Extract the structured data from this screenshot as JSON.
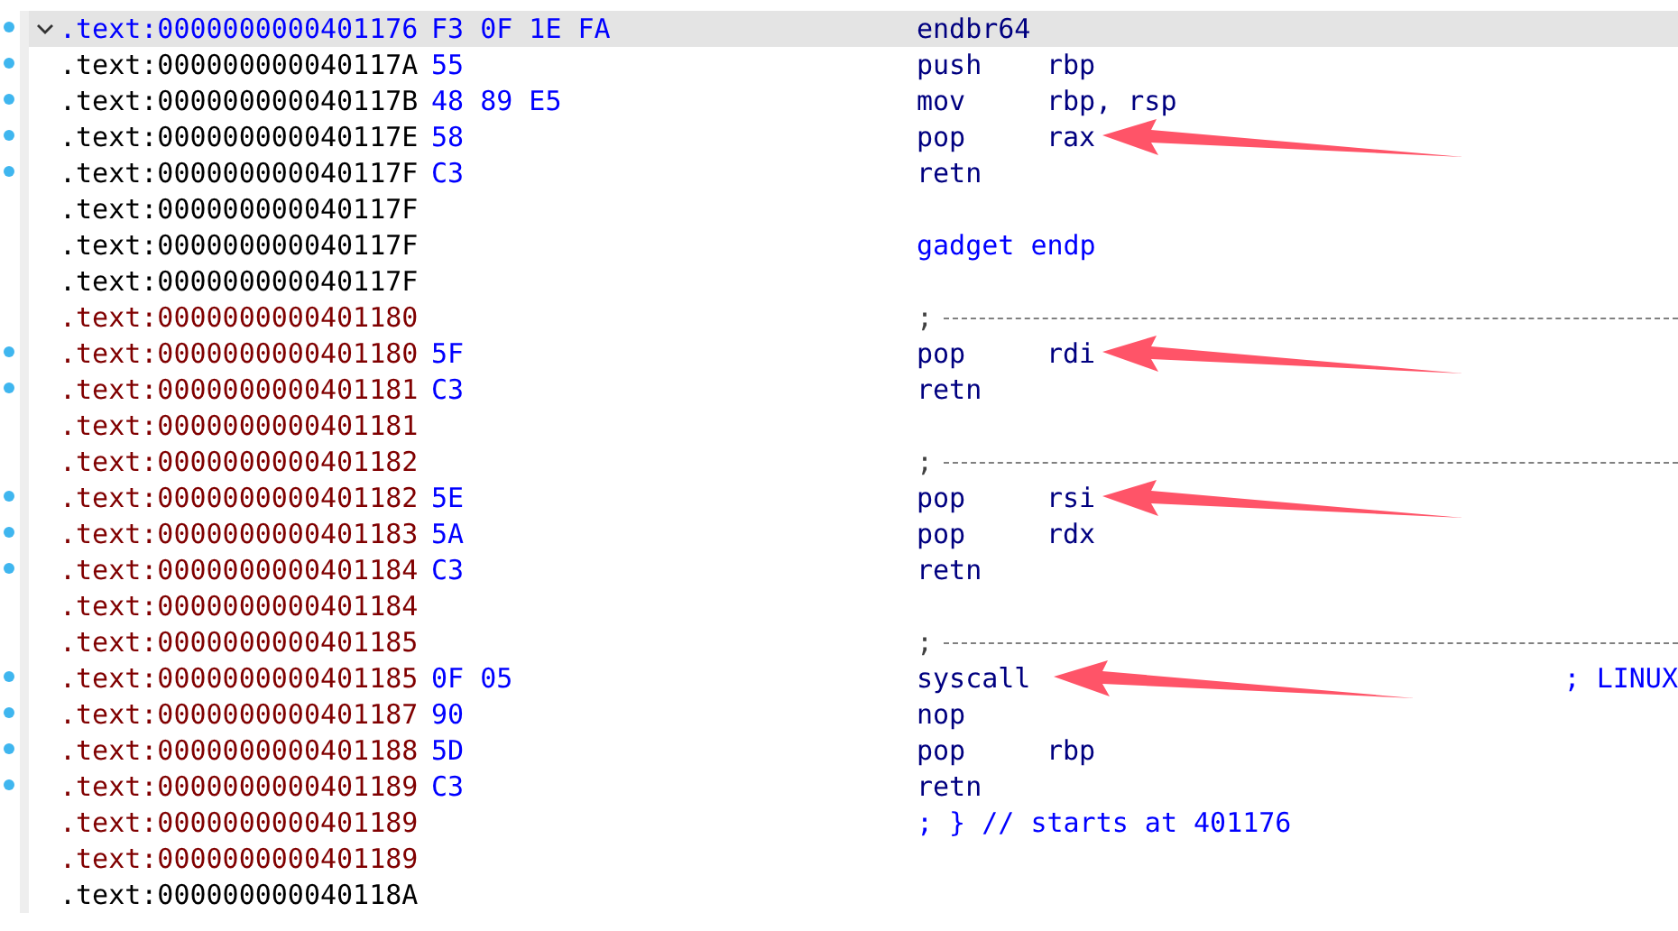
{
  "rows": [
    {
      "kind": "code",
      "address": ".text:0000000000401176",
      "color": "#0000ff",
      "marked": true,
      "selected": true,
      "expanded": true,
      "bytes": "F3 0F 1E FA",
      "mnemonic": "endbr64",
      "arrow": false
    },
    {
      "kind": "code",
      "address": ".text:000000000040117A",
      "color": "#000000",
      "marked": true,
      "selected": false,
      "bytes": "55",
      "mnemonic": "push",
      "operand": "rbp",
      "arrow": false
    },
    {
      "kind": "code",
      "address": ".text:000000000040117B",
      "color": "#000000",
      "marked": true,
      "selected": false,
      "bytes": "48 89 E5",
      "mnemonic": "mov",
      "operand": "rbp, rsp",
      "arrow": false
    },
    {
      "kind": "code",
      "address": ".text:000000000040117E",
      "color": "#000000",
      "marked": true,
      "selected": false,
      "bytes": "58",
      "mnemonic": "pop",
      "operand": "rax",
      "arrow": true
    },
    {
      "kind": "code",
      "address": ".text:000000000040117F",
      "color": "#000000",
      "marked": true,
      "selected": false,
      "bytes": "C3",
      "mnemonic": "retn",
      "arrow": false
    },
    {
      "kind": "blank",
      "address": ".text:000000000040117F",
      "color": "#000000",
      "marked": false,
      "selected": false
    },
    {
      "kind": "label",
      "address": ".text:000000000040117F",
      "color": "#000000",
      "marked": false,
      "selected": false,
      "text": "gadget endp"
    },
    {
      "kind": "blank",
      "address": ".text:000000000040117F",
      "color": "#000000",
      "marked": false,
      "selected": false
    },
    {
      "kind": "separator",
      "address": ".text:0000000000401180",
      "color": "#800000",
      "marked": false,
      "selected": false,
      "text": ";"
    },
    {
      "kind": "code",
      "address": ".text:0000000000401180",
      "color": "#800000",
      "marked": true,
      "selected": false,
      "bytes": "5F",
      "mnemonic": "pop",
      "operand": "rdi",
      "arrow": true
    },
    {
      "kind": "code",
      "address": ".text:0000000000401181",
      "color": "#800000",
      "marked": true,
      "selected": false,
      "bytes": "C3",
      "mnemonic": "retn",
      "arrow": false
    },
    {
      "kind": "blank",
      "address": ".text:0000000000401181",
      "color": "#800000",
      "marked": false,
      "selected": false
    },
    {
      "kind": "separator",
      "address": ".text:0000000000401182",
      "color": "#800000",
      "marked": false,
      "selected": false,
      "text": ";"
    },
    {
      "kind": "code",
      "address": ".text:0000000000401182",
      "color": "#800000",
      "marked": true,
      "selected": false,
      "bytes": "5E",
      "mnemonic": "pop",
      "operand": "rsi",
      "arrow": true
    },
    {
      "kind": "code",
      "address": ".text:0000000000401183",
      "color": "#800000",
      "marked": true,
      "selected": false,
      "bytes": "5A",
      "mnemonic": "pop",
      "operand": "rdx",
      "arrow": false
    },
    {
      "kind": "code",
      "address": ".text:0000000000401184",
      "color": "#800000",
      "marked": true,
      "selected": false,
      "bytes": "C3",
      "mnemonic": "retn",
      "arrow": false
    },
    {
      "kind": "blank",
      "address": ".text:0000000000401184",
      "color": "#800000",
      "marked": false,
      "selected": false
    },
    {
      "kind": "separator",
      "address": ".text:0000000000401185",
      "color": "#800000",
      "marked": false,
      "selected": false,
      "text": ";"
    },
    {
      "kind": "code",
      "address": ".text:0000000000401185",
      "color": "#800000",
      "marked": true,
      "selected": false,
      "bytes": "0F 05",
      "mnemonic": "syscall",
      "arrow": true,
      "comment": "; LINUX"
    },
    {
      "kind": "code",
      "address": ".text:0000000000401187",
      "color": "#800000",
      "marked": true,
      "selected": false,
      "bytes": "90",
      "mnemonic": "nop",
      "arrow": false
    },
    {
      "kind": "code",
      "address": ".text:0000000000401188",
      "color": "#800000",
      "marked": true,
      "selected": false,
      "bytes": "5D",
      "mnemonic": "pop",
      "operand": "rbp",
      "arrow": false
    },
    {
      "kind": "code",
      "address": ".text:0000000000401189",
      "color": "#800000",
      "marked": true,
      "selected": false,
      "bytes": "C3",
      "mnemonic": "retn",
      "arrow": false
    },
    {
      "kind": "comment",
      "address": ".text:0000000000401189",
      "color": "#800000",
      "marked": false,
      "selected": false,
      "text": "; } // starts at 401176"
    },
    {
      "kind": "blank",
      "address": ".text:0000000000401189",
      "color": "#800000",
      "marked": false,
      "selected": false
    },
    {
      "kind": "blank",
      "address": ".text:000000000040118A",
      "color": "#000000",
      "marked": false,
      "selected": false
    }
  ]
}
